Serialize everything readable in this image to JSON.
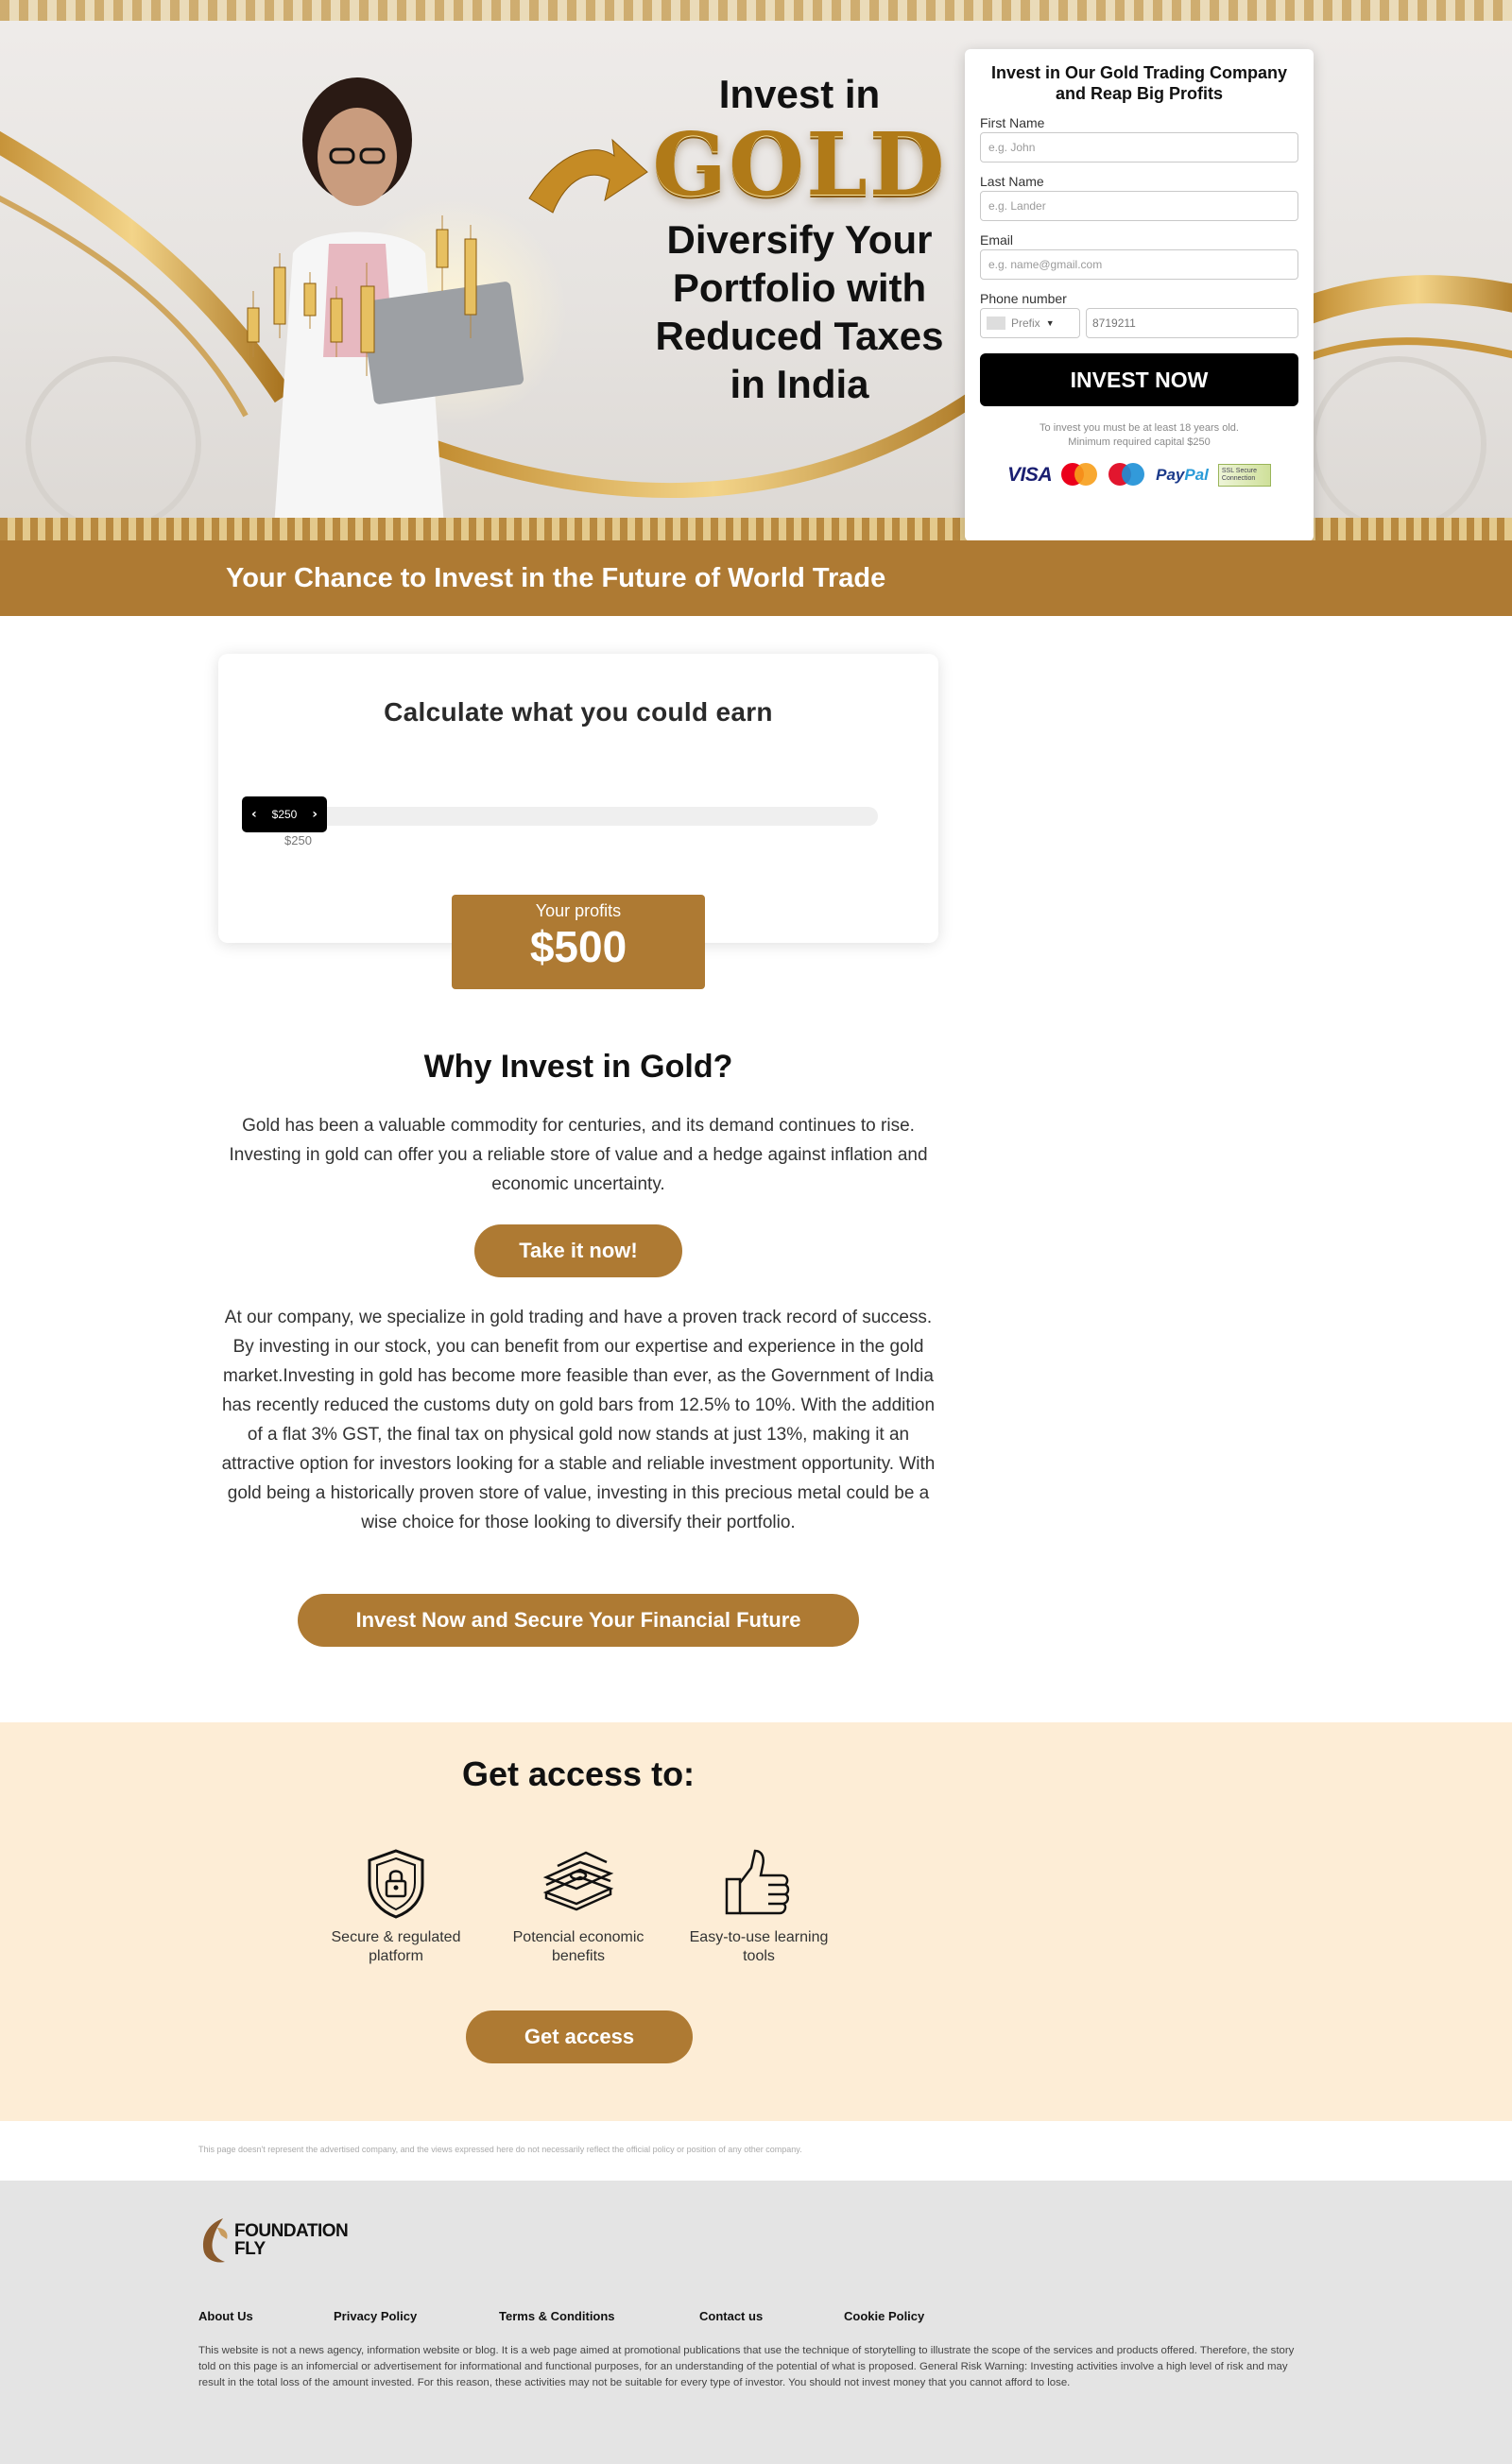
{
  "hero": {
    "line1": "Invest in",
    "gold_word": "GOLD",
    "subheading": "Diversify Your Portfolio with Reduced Taxes in India"
  },
  "form": {
    "title": "Invest in Our Gold Trading Company and Reap Big Profits",
    "first_name_label": "First Name",
    "first_name_placeholder": "e.g. John",
    "last_name_label": "Last Name",
    "last_name_placeholder": "e.g. Lander",
    "email_label": "Email",
    "email_placeholder": "e.g. name@gmail.com",
    "phone_label": "Phone number",
    "prefix_placeholder": "Prefix",
    "phone_placeholder": "8719211",
    "submit_label": "INVEST NOW",
    "note_line1": "To invest you must be at least 18 years old.",
    "note_line2": "Minimum required capital $250",
    "payments": {
      "visa": "VISA",
      "paypal_a": "Pay",
      "paypal_b": "Pal",
      "ssl": "SSL Secure Connection"
    }
  },
  "banner": {
    "text": "Your Chance to Invest in the Future of World Trade"
  },
  "calculator": {
    "title": "Calculate what you could earn",
    "slider_value": "$250",
    "slider_min_label": "$250",
    "slider_position": 0,
    "profits_label": "Your profits",
    "profits_value": "$500"
  },
  "why": {
    "title": "Why Invest in Gold?",
    "paragraph1": "Gold has been a valuable commodity for centuries, and its demand continues to rise. Investing in gold can offer you a reliable store of value and a hedge against inflation and economic uncertainty.",
    "cta1": "Take it now!",
    "paragraph2": "At our company, we specialize in gold trading and have a proven track record of success. By investing in our stock, you can benefit from our expertise and experience in the gold market.Investing in gold has become more feasible than ever, as the Government of India has recently reduced the customs duty on gold bars from 12.5% to 10%. With the addition of a flat 3% GST, the final tax on physical gold now stands at just 13%, making it an attractive option for investors looking for a stable and reliable investment opportunity. With gold being a historically proven store of value, investing in this precious metal could be a wise choice for those looking to diversify their portfolio.",
    "cta2": "Invest Now and Secure Your Financial Future"
  },
  "access": {
    "title": "Get access to:",
    "features": [
      {
        "label": "Secure & regulated platform",
        "icon": "shield-lock-icon"
      },
      {
        "label": "Potencial economic benefits",
        "icon": "money-stack-icon"
      },
      {
        "label": "Easy-to-use learning tools",
        "icon": "thumbs-up-icon"
      }
    ],
    "cta": "Get access"
  },
  "disclaimer": "This page doesn't represent the advertised company, and the views expressed here do not necessarily reflect the official policy or position of any other company.",
  "footer": {
    "logo_line1": "FOUNDATION",
    "logo_line2": "FLY",
    "links": [
      "About Us",
      "Privacy Policy",
      "Terms & Conditions",
      "Contact us",
      "Cookie Policy"
    ],
    "text": "This website is not a news agency, information website or blog. It is a web page aimed at promotional publications that use the technique of storytelling to illustrate the scope of the services and products offered. Therefore, the story told on this page is an infomercial or advertisement for informational and functional purposes, for an understanding of the potential of what is proposed. General Risk Warning: Investing activities involve a high level of risk and may result in the total loss of the amount invested. For this reason, these activities may not be suitable for every type of investor. You should not invest money that you cannot afford to lose."
  },
  "colors": {
    "brand_gold": "#ae7a33",
    "access_bg": "#fdedd6",
    "footer_bg": "#e4e4e4",
    "cta_black": "#000000"
  }
}
